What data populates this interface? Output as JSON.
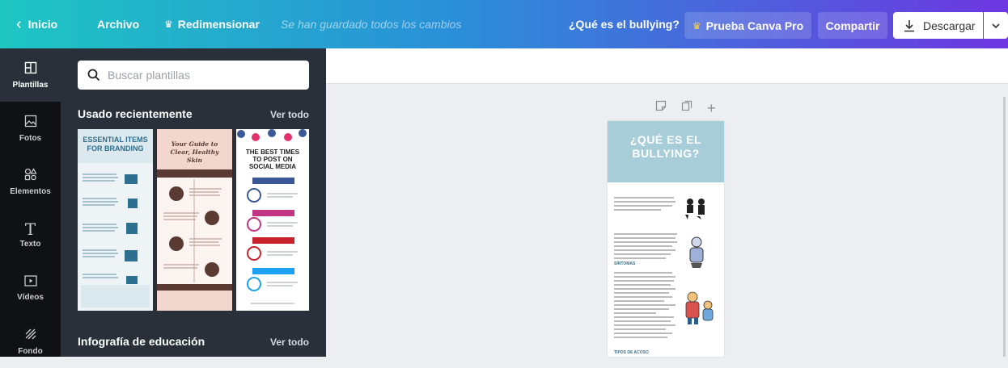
{
  "topbar": {
    "home_label": "Inicio",
    "file_label": "Archivo",
    "resize_label": "Redimensionar",
    "saved_status": "Se han guardado todos los cambios",
    "doc_title": "¿Qué es el bullying?",
    "pro_label": "Prueba Canva Pro",
    "share_label": "Compartir",
    "download_label": "Descargar"
  },
  "rail": [
    {
      "label": "Plantillas",
      "icon": "templates-icon"
    },
    {
      "label": "Fotos",
      "icon": "photos-icon"
    },
    {
      "label": "Elementos",
      "icon": "elements-icon"
    },
    {
      "label": "Texto",
      "icon": "text-icon"
    },
    {
      "label": "Vídeos",
      "icon": "videos-icon"
    },
    {
      "label": "Fondo",
      "icon": "background-icon"
    }
  ],
  "panel": {
    "search_placeholder": "Buscar plantillas",
    "recent_title": "Usado recientemente",
    "recent_link": "Ver todo",
    "edu_title": "Infografía de educación",
    "edu_link": "Ver todo",
    "templates": [
      {
        "title": "ESSENTIAL ITEMS FOR BRANDING",
        "sections": [
          "MARKET ANALYSIS",
          "COMPETITIVE ADVANTAGE",
          "BRAND VOICE AND NAME",
          "CORE BRANDING ASSETS",
          "VALUE PROPOSAL"
        ]
      },
      {
        "title": "Your Guide to Clear, Healthy Skin"
      },
      {
        "title": "THE BEST TIMES TO POST ON SOCIAL MEDIA",
        "sections": [
          "FACEBOOK",
          "INSTAGRAM",
          "PINTEREST",
          "TWITTER"
        ]
      }
    ]
  },
  "page": {
    "title": "¿QUÉ ES EL\nBULLYING?",
    "sub1": "SÍNTOMAS",
    "sub2": "TIPOS DE ACOSO"
  },
  "colors": {
    "topbar_start": "#1ec6c2",
    "topbar_end": "#6d37e0",
    "panel_bg": "#293039",
    "rail_bg": "#0f1114",
    "page_header": "#a7ced8"
  }
}
